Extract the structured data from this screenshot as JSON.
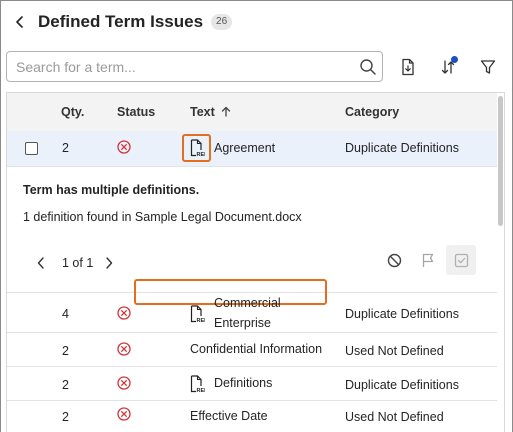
{
  "header": {
    "title": "Defined Term Issues",
    "count": "26"
  },
  "search": {
    "placeholder": "Search for a term...",
    "value": ""
  },
  "table": {
    "columns": {
      "qty": "Qty.",
      "status": "Status",
      "text": "Text",
      "category": "Category"
    },
    "rows": [
      {
        "qty": "2",
        "text": "Agreement",
        "category": "Duplicate Definitions",
        "has_ref_icon": true,
        "selected": true
      },
      {
        "qty": "4",
        "text_line1": "Commercial",
        "text_line2": "Enterprise",
        "category": "Duplicate Definitions",
        "has_ref_icon": true
      },
      {
        "qty": "2",
        "text": "Confidential Information",
        "category": "Used Not Defined",
        "has_ref_icon": false
      },
      {
        "qty": "2",
        "text": "Definitions",
        "category": "Duplicate Definitions",
        "has_ref_icon": true
      },
      {
        "qty": "2",
        "text": "Effective Date",
        "category": "Used Not Defined",
        "has_ref_icon": false
      }
    ]
  },
  "details": {
    "title": "Term has multiple definitions.",
    "text_prefix": "1 definition found in",
    "document_link": "Sample Legal Document.docx",
    "pager": "1 of 1"
  },
  "colors": {
    "status_error": "#d13438",
    "highlight": "#e36f1e",
    "notification_dot": "#1a4fc8",
    "selected_row": "#eaf1fb"
  },
  "icons": {
    "back": "chevron-left-icon",
    "search": "search-icon",
    "export": "document-export-icon",
    "sort": "sort-icon",
    "filter": "filter-icon",
    "status": "error-circle-icon",
    "term_ref": "document-ref-icon",
    "ignore": "block-icon",
    "flag": "flag-icon",
    "check": "checkbox-check-icon"
  }
}
